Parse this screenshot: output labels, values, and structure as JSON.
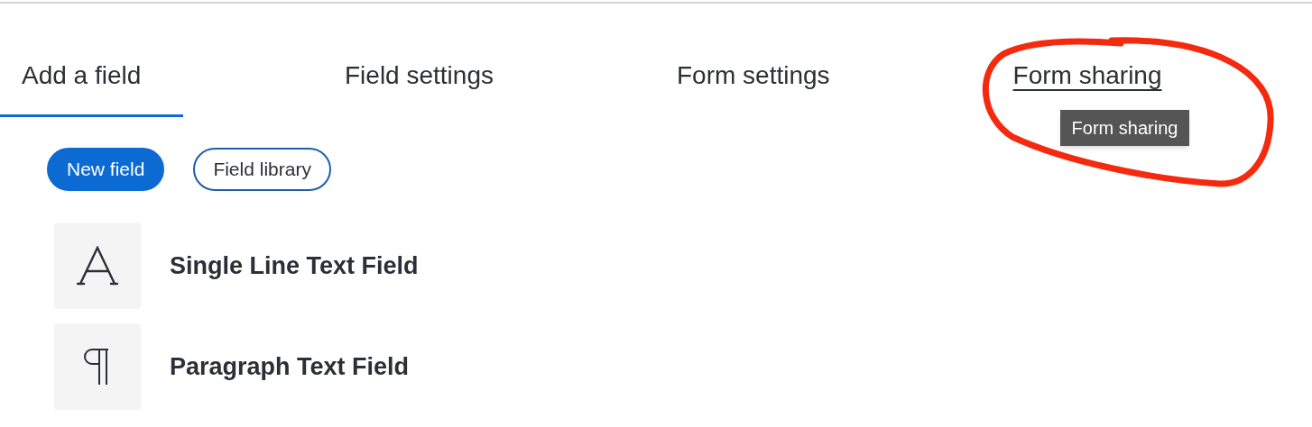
{
  "tabs": [
    {
      "label": "Add a field",
      "selected": true,
      "hovered": false
    },
    {
      "label": "Field settings",
      "selected": false,
      "hovered": false
    },
    {
      "label": "Form settings",
      "selected": false,
      "hovered": false
    },
    {
      "label": "Form sharing",
      "selected": false,
      "hovered": true
    }
  ],
  "tooltip": "Form sharing",
  "buttons": [
    {
      "label": "New field",
      "kind": "primary"
    },
    {
      "label": "Field library",
      "kind": "outline"
    }
  ],
  "fields": [
    {
      "label": "Single Line Text Field",
      "kind": "letter"
    },
    {
      "label": "Paragraph Text Field",
      "kind": "paragraph"
    }
  ]
}
